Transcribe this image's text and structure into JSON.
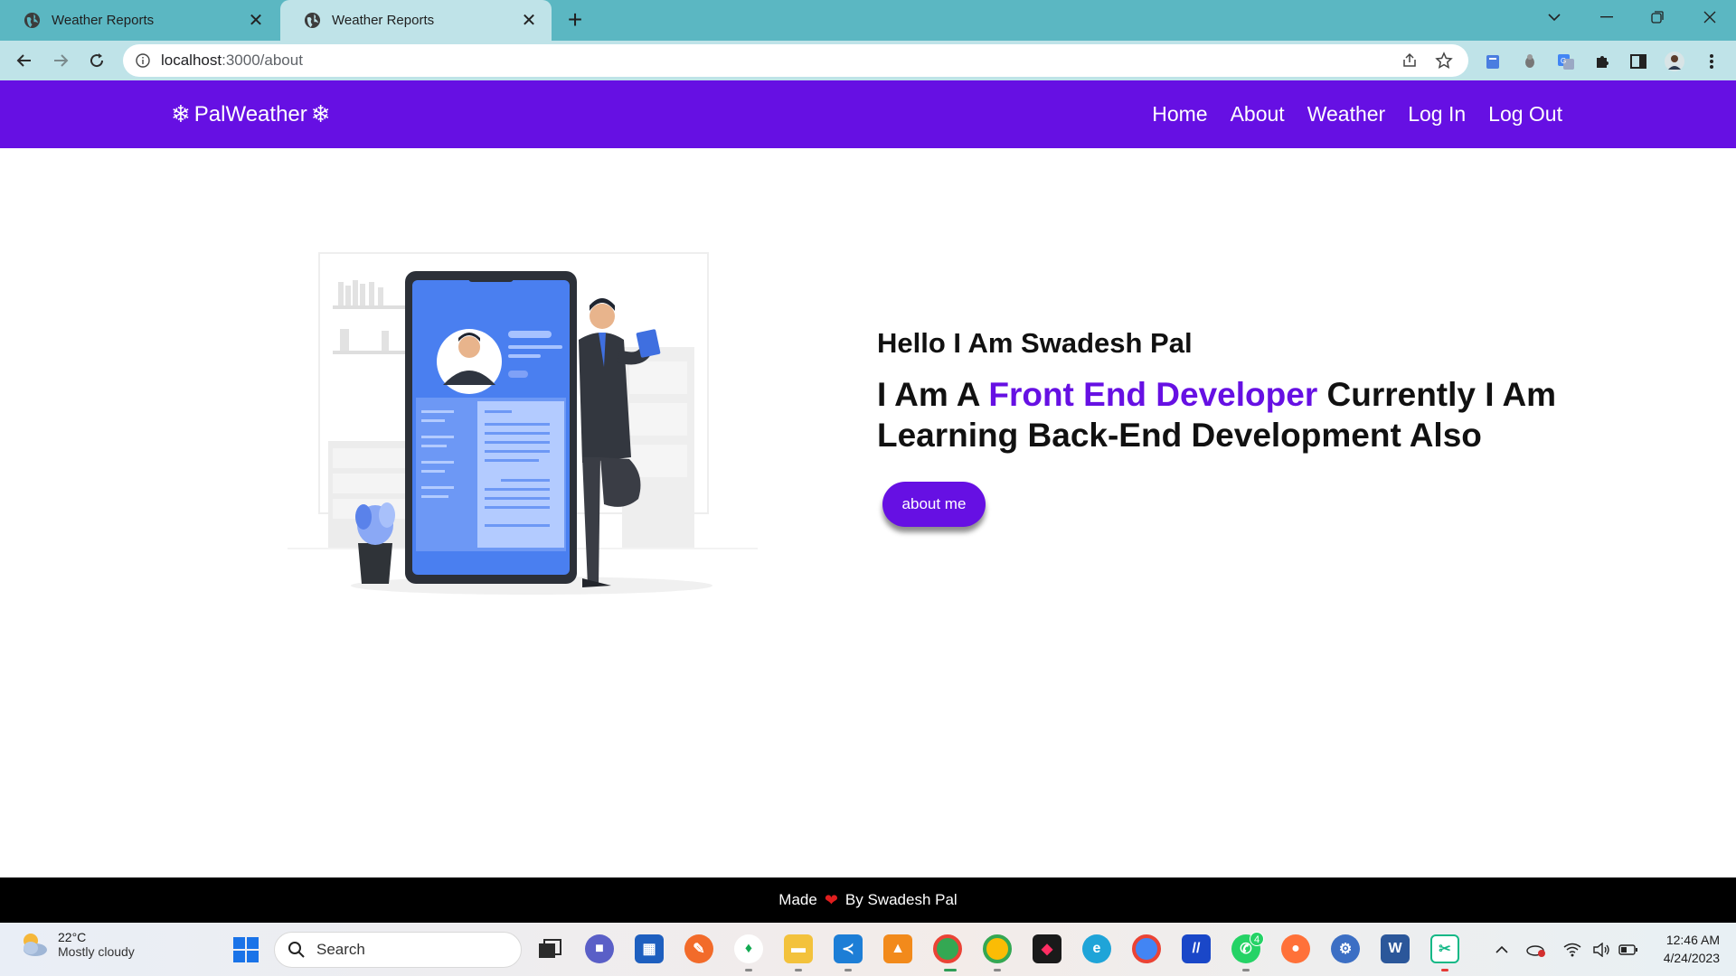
{
  "browser": {
    "tabs": [
      {
        "title": "Weather Reports",
        "active": false
      },
      {
        "title": "Weather Reports",
        "active": true
      }
    ],
    "url_host": "localhost",
    "url_path": ":3000/about"
  },
  "site": {
    "brand": "PalWeather",
    "brand_icon": "snowflake-icon",
    "nav": [
      "Home",
      "About",
      "Weather",
      "Log In",
      "Log Out"
    ]
  },
  "hero": {
    "greeting": "Hello I Am Swadesh Pal",
    "line_prefix": "I Am A ",
    "line_accent": "Front End Developer",
    "line_suffix": " Currently I Am Learning Back-End Development Also",
    "button": "about me",
    "illustration_icon": "developer-illustration"
  },
  "footer": {
    "made": "Made",
    "by": "By Swadesh Pal"
  },
  "taskbar": {
    "weather_temp": "22°C",
    "weather_cond": "Mostly cloudy",
    "search_label": "Search",
    "time": "12:46 AM",
    "date": "4/24/2023",
    "whatsapp_badge": "4"
  },
  "colors": {
    "brand_purple": "#6610e3",
    "tab_bar": "#5bb7c2",
    "toolbar": "#bfe3e8",
    "footer": "#000000"
  }
}
